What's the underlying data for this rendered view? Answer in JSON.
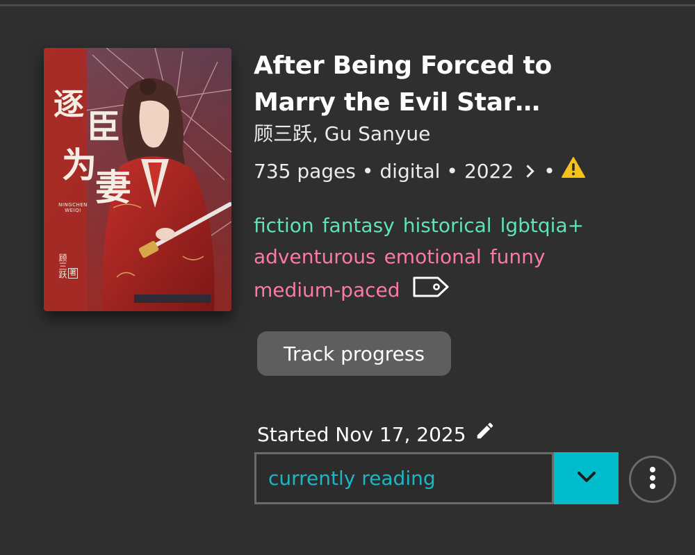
{
  "book": {
    "title": "After Being Forced to Marry the Evil Star…",
    "author": "顾三跃, Gu Sanyue",
    "pages": "735 pages",
    "format": "digital",
    "year": "2022",
    "separator": "•",
    "cover": {
      "title_glyphs": "逐臣为妻",
      "romanized": "NINGCHEN WEIQI",
      "author_glyphs": "顾三跃",
      "author_mark": "著"
    }
  },
  "tags": {
    "genres": [
      "fiction",
      "fantasy",
      "historical",
      "lgbtqia+"
    ],
    "moods_row1": [
      "adventurous",
      "emotional",
      "funny"
    ],
    "pace": "medium-paced"
  },
  "actions": {
    "track_label": "Track progress",
    "started_label": "Started Nov 17, 2025",
    "status_value": "currently reading"
  },
  "icons": {
    "warning": "warning-icon",
    "tag": "tag-icon",
    "edit": "pencil-icon",
    "dropdown": "chevron-down-icon",
    "more": "more-vertical-icon",
    "meta_more": "chevron-right-icon"
  },
  "colors": {
    "background": "#2f2f2f",
    "genre_tag": "#5fe3b8",
    "mood_tag": "#ff79a6",
    "status_text": "#19b8c6",
    "status_accent": "#00bccd",
    "warning": "#f5c21a",
    "track_button": "#5e5e5e"
  }
}
